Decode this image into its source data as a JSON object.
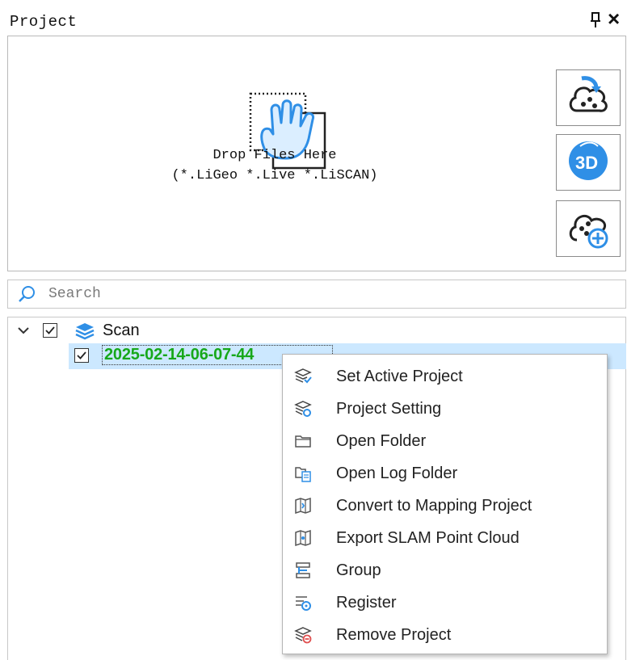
{
  "panel": {
    "title": "Project",
    "pin_icon": "pin-icon",
    "close_icon": "close-icon"
  },
  "dropzone": {
    "line1": "Drop Files Here",
    "line2": "(*.LiGeo *.Live *.LiSCAN)",
    "icon": "hand-drop-icon",
    "side_buttons": [
      {
        "name": "open-cloud-button",
        "icon": "cloud-open-icon"
      },
      {
        "name": "3d-view-button",
        "icon": "3d-globe-icon"
      },
      {
        "name": "add-cloud-button",
        "icon": "cloud-add-icon"
      }
    ]
  },
  "search": {
    "placeholder": "Search"
  },
  "tree": {
    "root": {
      "label": "Scan",
      "checked": true,
      "expanded": true
    },
    "child": {
      "label": "2025-02-14-06-07-44",
      "checked": true,
      "color": "#17a81a"
    }
  },
  "context_menu": {
    "items": [
      {
        "label": "Set Active Project",
        "icon": "layers-check-icon"
      },
      {
        "label": "Project Setting",
        "icon": "layers-gear-icon"
      },
      {
        "label": "Open Folder",
        "icon": "folder-icon"
      },
      {
        "label": "Open Log Folder",
        "icon": "log-folder-icon"
      },
      {
        "label": "Convert to Mapping Project",
        "icon": "map-convert-icon"
      },
      {
        "label": "Export SLAM Point Cloud",
        "icon": "map-export-icon"
      },
      {
        "label": "Group",
        "icon": "group-icon"
      },
      {
        "label": "Register",
        "icon": "register-icon"
      },
      {
        "label": "Remove Project",
        "icon": "layers-remove-icon"
      }
    ]
  },
  "colors": {
    "accent_blue": "#2f8fe6",
    "selection": "#cce8ff",
    "active_green": "#17a81a"
  }
}
